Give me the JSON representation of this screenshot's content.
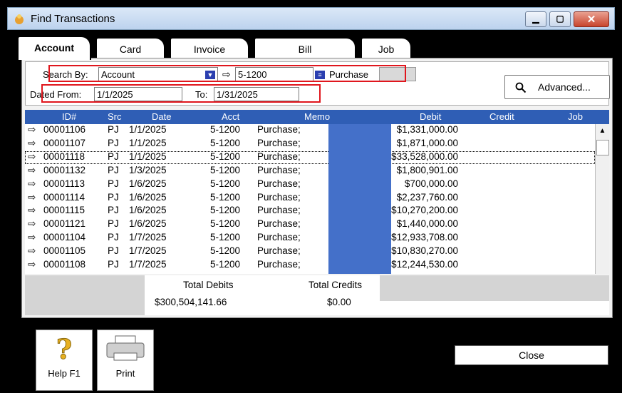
{
  "window": {
    "title": "Find Transactions"
  },
  "tabs": [
    {
      "label": "Account"
    },
    {
      "label": "Card"
    },
    {
      "label": "Invoice"
    },
    {
      "label": "Bill"
    },
    {
      "label": "Job"
    }
  ],
  "criteria": {
    "search_by_label": "Search By:",
    "search_by_value": "Account",
    "account_value": "5-1200",
    "account_name": "Purchase",
    "dated_from_label": "Dated From:",
    "dated_from_value": "1/1/2025",
    "to_label": "To:",
    "to_value": "1/31/2025"
  },
  "advanced_label": "Advanced...",
  "columns": [
    "ID#",
    "Src",
    "Date",
    "Acct",
    "Memo",
    "Debit",
    "Credit",
    "Job"
  ],
  "rows": [
    {
      "id": "00001106",
      "src": "PJ",
      "date": "1/1/2025",
      "acct": "5-1200",
      "memo": "Purchase;",
      "debit": "$1,331,000.00"
    },
    {
      "id": "00001107",
      "src": "PJ",
      "date": "1/1/2025",
      "acct": "5-1200",
      "memo": "Purchase;",
      "debit": "$1,871,000.00"
    },
    {
      "id": "00001118",
      "src": "PJ",
      "date": "1/1/2025",
      "acct": "5-1200",
      "memo": "Purchase;",
      "debit": "$33,528,000.00"
    },
    {
      "id": "00001132",
      "src": "PJ",
      "date": "1/3/2025",
      "acct": "5-1200",
      "memo": "Purchase;",
      "debit": "$1,800,901.00"
    },
    {
      "id": "00001113",
      "src": "PJ",
      "date": "1/6/2025",
      "acct": "5-1200",
      "memo": "Purchase;",
      "debit": "$700,000.00"
    },
    {
      "id": "00001114",
      "src": "PJ",
      "date": "1/6/2025",
      "acct": "5-1200",
      "memo": "Purchase;",
      "debit": "$2,237,760.00"
    },
    {
      "id": "00001115",
      "src": "PJ",
      "date": "1/6/2025",
      "acct": "5-1200",
      "memo": "Purchase;",
      "debit": "$10,270,200.00"
    },
    {
      "id": "00001121",
      "src": "PJ",
      "date": "1/6/2025",
      "acct": "5-1200",
      "memo": "Purchase;",
      "debit": "$1,440,000.00"
    },
    {
      "id": "00001104",
      "src": "PJ",
      "date": "1/7/2025",
      "acct": "5-1200",
      "memo": "Purchase;",
      "debit": "$12,933,708.00"
    },
    {
      "id": "00001105",
      "src": "PJ",
      "date": "1/7/2025",
      "acct": "5-1200",
      "memo": "Purchase;",
      "debit": "$10,830,270.00"
    },
    {
      "id": "00001108",
      "src": "PJ",
      "date": "1/7/2025",
      "acct": "5-1200",
      "memo": "Purchase;",
      "debit": "$12,244,530.00"
    }
  ],
  "totals": {
    "debits_label": "Total Debits",
    "debits_value": "$300,504,141.66",
    "credits_label": "Total Credits",
    "credits_value": "$0.00"
  },
  "buttons": {
    "help": "Help F1",
    "print": "Print",
    "close": "Close"
  },
  "icons": {
    "row_arrow": "arrow-right-icon",
    "zoom": "search-icon"
  },
  "colors": {
    "header_bg": "#2f5eb5",
    "highlight": "#e0161d",
    "memo_mask": "#4470c9"
  }
}
